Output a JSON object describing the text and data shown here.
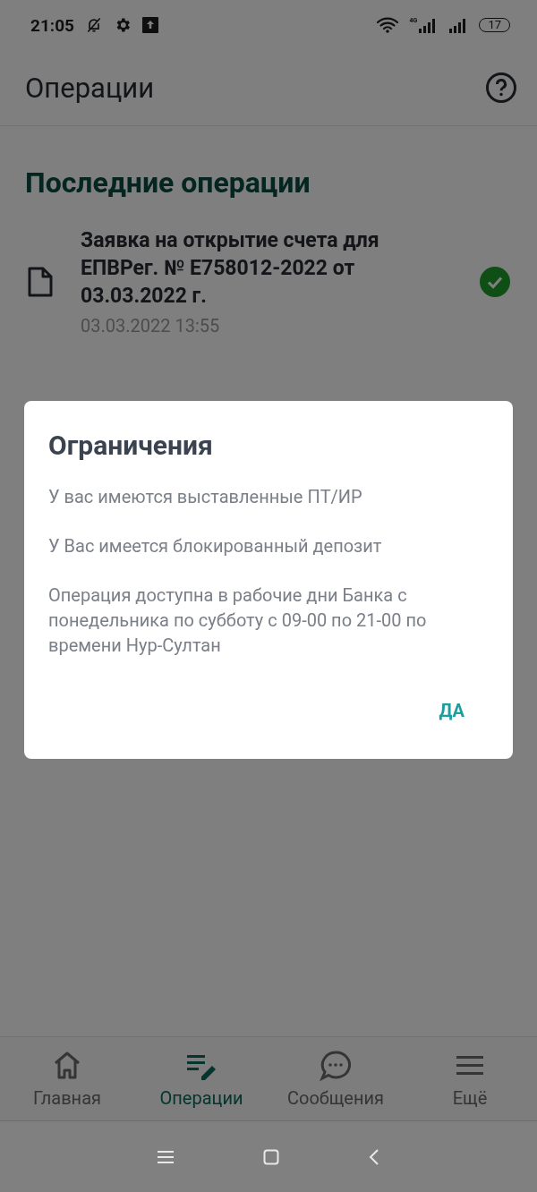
{
  "status_bar": {
    "time": "21:05",
    "network": "4G",
    "battery": "17"
  },
  "app_bar": {
    "title": "Операции"
  },
  "section_title": "Последние операции",
  "operations": [
    {
      "title": "Заявка на открытие счета для ЕПВРег. № E758012-2022 от 03.03.2022 г.",
      "date": "03.03.2022 13:55",
      "completed": true
    }
  ],
  "dialog": {
    "title": "Ограничения",
    "messages": [
      "У вас имеются выставленные ПТ/ИР",
      "У Вас имеется блокированный депозит",
      "Операция доступна в рабочие дни Банка с понедельника по субботу с 09-00 по 21-00 по времени Нур-Султан"
    ],
    "button": "ДА"
  },
  "bottom_nav": [
    {
      "label": "Главная",
      "kind": "home",
      "selected": false
    },
    {
      "label": "Операции",
      "kind": "operations",
      "selected": true
    },
    {
      "label": "Сообщения",
      "kind": "chat",
      "selected": false
    },
    {
      "label": "Ещё",
      "kind": "menu",
      "selected": false
    }
  ]
}
